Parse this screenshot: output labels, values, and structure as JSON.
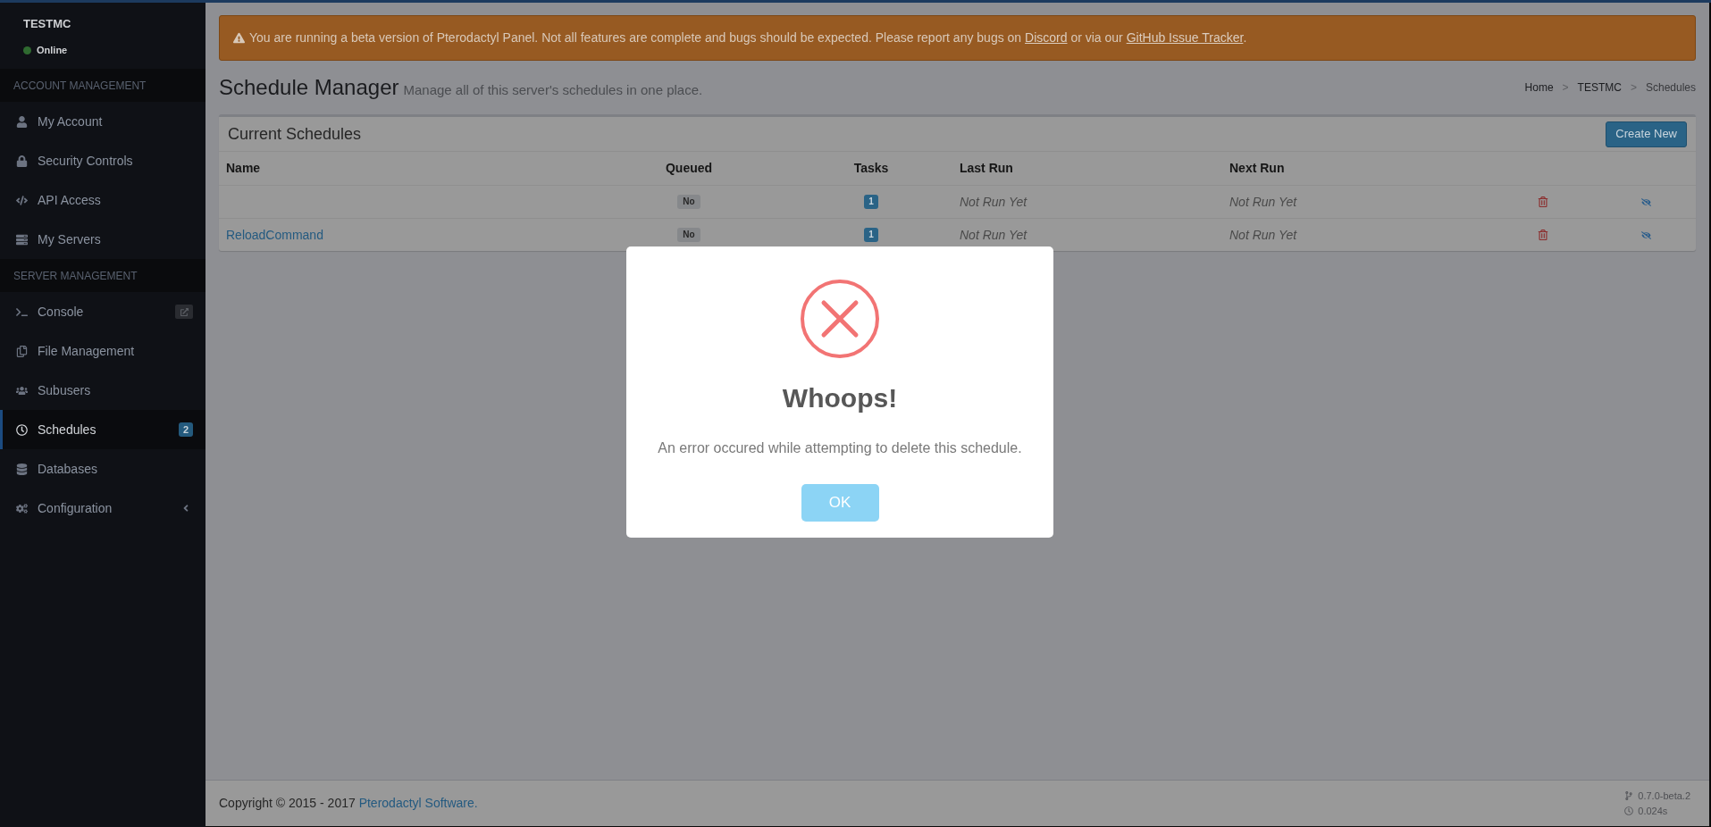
{
  "sidebar": {
    "server": {
      "name": "TESTMC",
      "status": "Online",
      "online": true
    },
    "sections": [
      {
        "title": "ACCOUNT MANAGEMENT",
        "items": [
          {
            "label": "My Account",
            "selected": false
          },
          {
            "label": "Security Controls",
            "selected": false
          },
          {
            "label": "API Access",
            "selected": false
          },
          {
            "label": "My Servers",
            "selected": false
          }
        ]
      },
      {
        "title": "SERVER MANAGEMENT",
        "items": [
          {
            "label": "Console",
            "selected": false,
            "popout": true
          },
          {
            "label": "File Management",
            "selected": false
          },
          {
            "label": "Subusers",
            "selected": false
          },
          {
            "label": "Schedules",
            "selected": true,
            "badge": "2"
          },
          {
            "label": "Databases",
            "selected": false
          },
          {
            "label": "Configuration",
            "selected": false,
            "expanded": false
          }
        ]
      }
    ]
  },
  "alert": {
    "segments": [
      {
        "kind": "text",
        "text": "You are running a beta version of Pterodactyl Panel. Not all features are complete and bugs should be expected. Please report any bugs on "
      },
      {
        "kind": "link",
        "text": "Discord"
      },
      {
        "kind": "text",
        "text": " or via our "
      },
      {
        "kind": "link",
        "text": "GitHub Issue Tracker"
      },
      {
        "kind": "text",
        "text": "."
      }
    ]
  },
  "page_header": {
    "title": "Schedule Manager",
    "subtitle": "Manage all of this server's schedules in one place."
  },
  "breadcrumb": {
    "items": [
      {
        "label": "Home",
        "current": false
      },
      {
        "label": "TESTMC",
        "current": false
      },
      {
        "label": "Schedules",
        "current": true
      }
    ],
    "separators": [
      ">",
      ">"
    ]
  },
  "schedules": {
    "title": "Current Schedules",
    "create_button": "Create New",
    "columns": [
      "Name",
      "Queued",
      "Tasks",
      "Last Run",
      "Next Run"
    ],
    "rows": [
      {
        "queued": "No",
        "tasks": "1",
        "last_run": "Not Run Yet",
        "next_run": "Not Run Yet"
      },
      {
        "name": "ReloadCommand",
        "queued": "No",
        "tasks": "1",
        "last_run": "Not Run Yet",
        "next_run": "Not Run Yet"
      }
    ]
  },
  "modal": {
    "kind": "error",
    "title": "Whoops!",
    "text": "An error occured while attempting to delete this schedule.",
    "button": "OK"
  },
  "footer": {
    "copyright": [
      {
        "kind": "text",
        "text": "Copyright © 2015 - 2017 "
      },
      {
        "kind": "link",
        "text": "Pterodactyl Software."
      }
    ],
    "version": "0.7.0-beta.2",
    "timing": "0.024s"
  }
}
